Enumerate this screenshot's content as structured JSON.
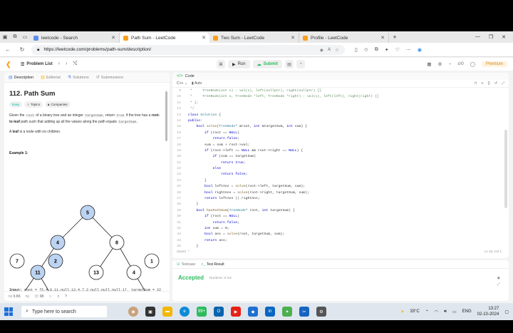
{
  "browser": {
    "tabs": [
      {
        "title": "leetcode - Search",
        "color": "#5b8def"
      },
      {
        "title": "Path Sum - LeetCode",
        "color": "#f89f1b"
      },
      {
        "title": "Two Sum - LeetCode",
        "color": "#f89f1b"
      },
      {
        "title": "Profile - LeetCode",
        "color": "#f89f1b"
      }
    ],
    "url": "https://leetcode.com/problems/path-sum/description/"
  },
  "lcnav": {
    "problem_list": "Problem List",
    "run": "Run",
    "submit": "Submit",
    "streak": "0",
    "premium": "Premium"
  },
  "left": {
    "tabs": [
      "Description",
      "Editorial",
      "Solutions",
      "Submissions"
    ],
    "title": "112. Path Sum",
    "tags": [
      "Easy",
      "Topics",
      "Companies"
    ],
    "desc_1": "Given the",
    "root": "root",
    "desc_2": "of a binary tree and an integer",
    "targetSum": "targetSum",
    "desc_3": ", return",
    "true_kw": "true",
    "desc_4": "if the tree has a",
    "root_to_leaf": "root-to-leaf",
    "desc_5": "path such that adding up all the values along the path equals",
    "desc_6": ".",
    "leaf_bold": "leaf",
    "leaf_1": "A",
    "leaf_2": "is a node with no children.",
    "example": "Example 1:",
    "tree_nodes": [
      "5",
      "4",
      "8",
      "11",
      "13",
      "4",
      "7",
      "2",
      "1"
    ],
    "input_label": "Input:",
    "input_value": "root = [5,4,8,11,null,13,4,7,2,null,null,null,1], targetSum = 22",
    "likes": "9.8K",
    "comments": "98"
  },
  "editor": {
    "header": "Code",
    "language": "C++",
    "mode": "Auto",
    "lines": [
      {
        "n": "9",
        "t": " *     TreeNode(int x) : val(x), left(nullptr), right(nullptr) {}"
      },
      {
        "n": "10",
        "t": " *     TreeNode(int x, TreeNode *left, TreeNode *right) : val(x), left(left), right(right) {}"
      },
      {
        "n": "11",
        "t": " * };"
      },
      {
        "n": "12",
        "t": " */"
      },
      {
        "n": "13",
        "t": "class Solution {"
      },
      {
        "n": "14",
        "t": "public:"
      },
      {
        "n": "15",
        "t": "    bool solve(TreeNode* &root, int &targetSum, int sum) {"
      },
      {
        "n": "16",
        "t": "        if (root == NULL)"
      },
      {
        "n": "17",
        "t": "            return false;"
      },
      {
        "n": "18",
        "t": "        sum = sum + root->val;"
      },
      {
        "n": "19",
        "t": "        if (root->left == NULL && root->right == NULL) {"
      },
      {
        "n": "20",
        "t": "            if (sum == targetSum)"
      },
      {
        "n": "21",
        "t": "                return true;"
      },
      {
        "n": "22",
        "t": "            else"
      },
      {
        "n": "23",
        "t": "                return false;"
      },
      {
        "n": "24",
        "t": "        }"
      },
      {
        "n": "25",
        "t": "        bool leftAns = solve(root->left, targetSum, sum);"
      },
      {
        "n": "26",
        "t": "        bool rightAns = solve(root->right, targetSum, sum);"
      },
      {
        "n": "27",
        "t": "        return leftAns || rightAns;"
      },
      {
        "n": "28",
        "t": "    }"
      },
      {
        "n": "29",
        "t": "    bool hasPathSum(TreeNode* root, int targetSum) {"
      },
      {
        "n": "30",
        "t": "        if (root == NULL)"
      },
      {
        "n": "31",
        "t": "            return false;"
      },
      {
        "n": "32",
        "t": "        int sum = 0;"
      },
      {
        "n": "33",
        "t": "        bool ans = solve(root, targetSum, sum);"
      },
      {
        "n": "34",
        "t": "        return ans;"
      },
      {
        "n": "35",
        "t": "    }"
      },
      {
        "n": "36",
        "t": "};"
      }
    ],
    "saved": "Saved",
    "position": "Ln 18, Col 1"
  },
  "bottom": {
    "tabs": [
      "Testcase",
      "Test Result"
    ],
    "status": "Accepted",
    "runtime": "Runtime: 0 ms"
  },
  "taskbar": {
    "search": "Type here to search",
    "weather": "33°C",
    "lang": "ENG",
    "time": "13:27",
    "date": "02-10-2024"
  }
}
